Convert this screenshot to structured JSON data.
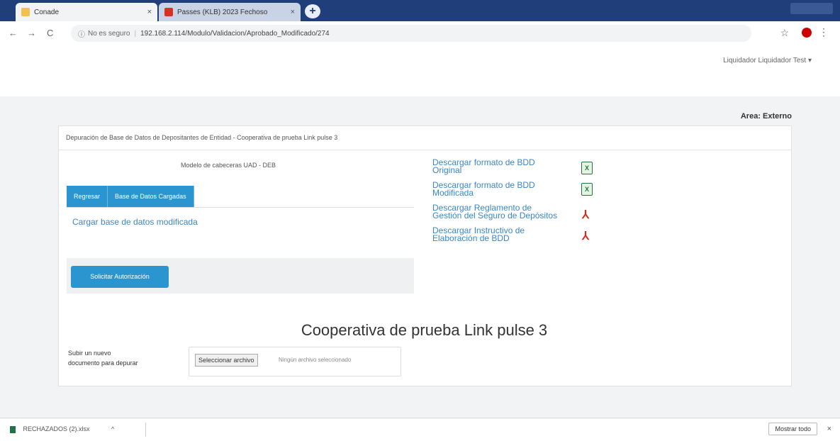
{
  "browser": {
    "tabs": [
      {
        "title": "Conade",
        "close": "×",
        "favicon_color": "#f2c14e"
      },
      {
        "title": "Passes (KLB) 2023 Fechoso",
        "close": "×",
        "favicon_color": "#d93025"
      }
    ],
    "new_tab": "+",
    "nav": {
      "back": "←",
      "forward": "→",
      "reload": "C"
    },
    "address": {
      "security": "No es seguro",
      "url": "192.168.2.114/Modulo/Validacion/Aprobado_Modificado/274"
    },
    "star": "☆",
    "menu": "⋮"
  },
  "user_menu": "Liquidador Liquidador Test ▾",
  "area_label": "Area: Externo",
  "panel_header": "Depuración de Base de Datos de Depositantes de Entidad - Cooperativa de prueba Link pulse 3",
  "modelo_text": "Modelo de cabeceras UAD - DEB",
  "tabs": [
    "Regresar",
    "Base de Datos Cargadas"
  ],
  "cargar_link": "Cargar base de datos modificada",
  "solicitar_button": "Solicitar Autorización",
  "downloads": [
    {
      "line1": "Descargar formato de BDD",
      "line2": "Original",
      "icon": "excel-icon"
    },
    {
      "line1": "Descargar formato de BDD",
      "line2": "Modificada",
      "icon": "excel-icon"
    },
    {
      "line1": "Descargar Reglamento de",
      "line2": "Gestión del Seguro de Depósitos",
      "icon": "pdf-icon"
    },
    {
      "line1": "Descargar Instructivo de",
      "line2": "Elaboración de BDD",
      "icon": "pdf-icon"
    }
  ],
  "coop_title": "Cooperativa de prueba Link pulse 3",
  "upload": {
    "label_line1": "Subir un nuevo",
    "label_line2": "documento para depurar",
    "button": "Seleccionar archivo",
    "status": "Ningún archivo seleccionado"
  },
  "download_bar": {
    "file": "RECHAZADOS (2).xlsx",
    "chevron": "^",
    "show_all": "Mostrar todo",
    "close": "×"
  },
  "colors": {
    "accent": "#2b95d0",
    "link": "#3a86c8",
    "tabbar": "#1f3e7a"
  }
}
